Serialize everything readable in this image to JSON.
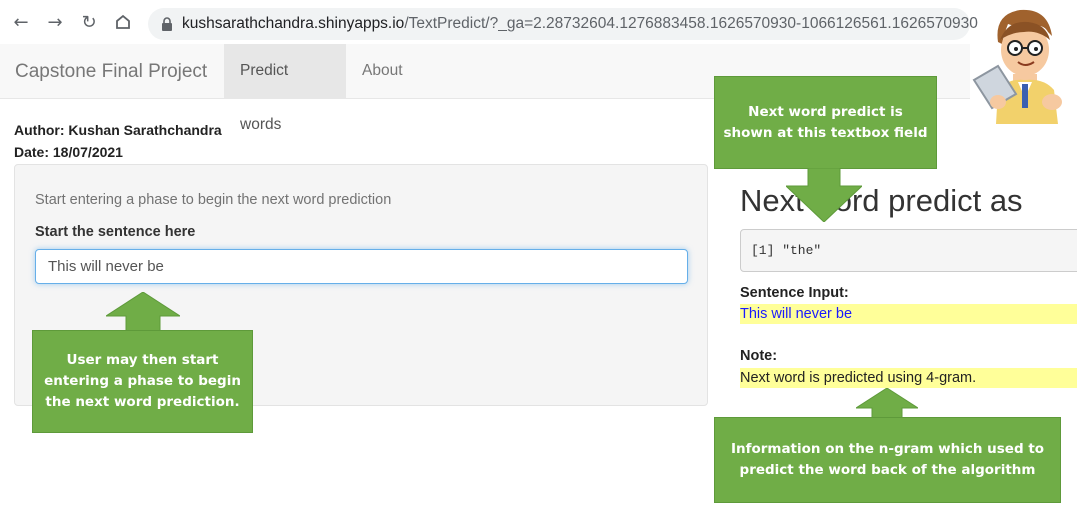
{
  "browser": {
    "url_host": "kushsarathchandra.shinyapps.io",
    "url_path": "/TextPredict/?_ga=2.28732604.1276883458.1626570930-1066126561.1626570930"
  },
  "navbar": {
    "brand": "Capstone Final Project",
    "tabs": [
      {
        "label": "Predict words",
        "active": true
      },
      {
        "label": "About",
        "active": false
      }
    ]
  },
  "meta": {
    "author": "Author: Kushan Sarathchandra",
    "date": "Date: 18/07/2021"
  },
  "sidebar": {
    "help_text": "Start entering a phase to begin the next word prediction",
    "input_label": "Start the sentence here",
    "input_value": "This will never be"
  },
  "main": {
    "title": "Next word predict as",
    "prediction_output": "[1] \"the\"",
    "sentence_label": "Sentence Input:",
    "sentence_value": "This will never be",
    "note_label": "Note:",
    "note_value": "Next word is predicted using 4-gram."
  },
  "callouts": {
    "top": "Next word predict is shown at this textbox field",
    "left": "User may then start entering a phase to begin the next word prediction.",
    "bottom": "Information on the n-gram which used to predict the word back of the algorithm"
  },
  "colors": {
    "callout_green": "#70ad47",
    "highlight_yellow": "#ffff99",
    "active_tab": "#e7e7e7"
  }
}
